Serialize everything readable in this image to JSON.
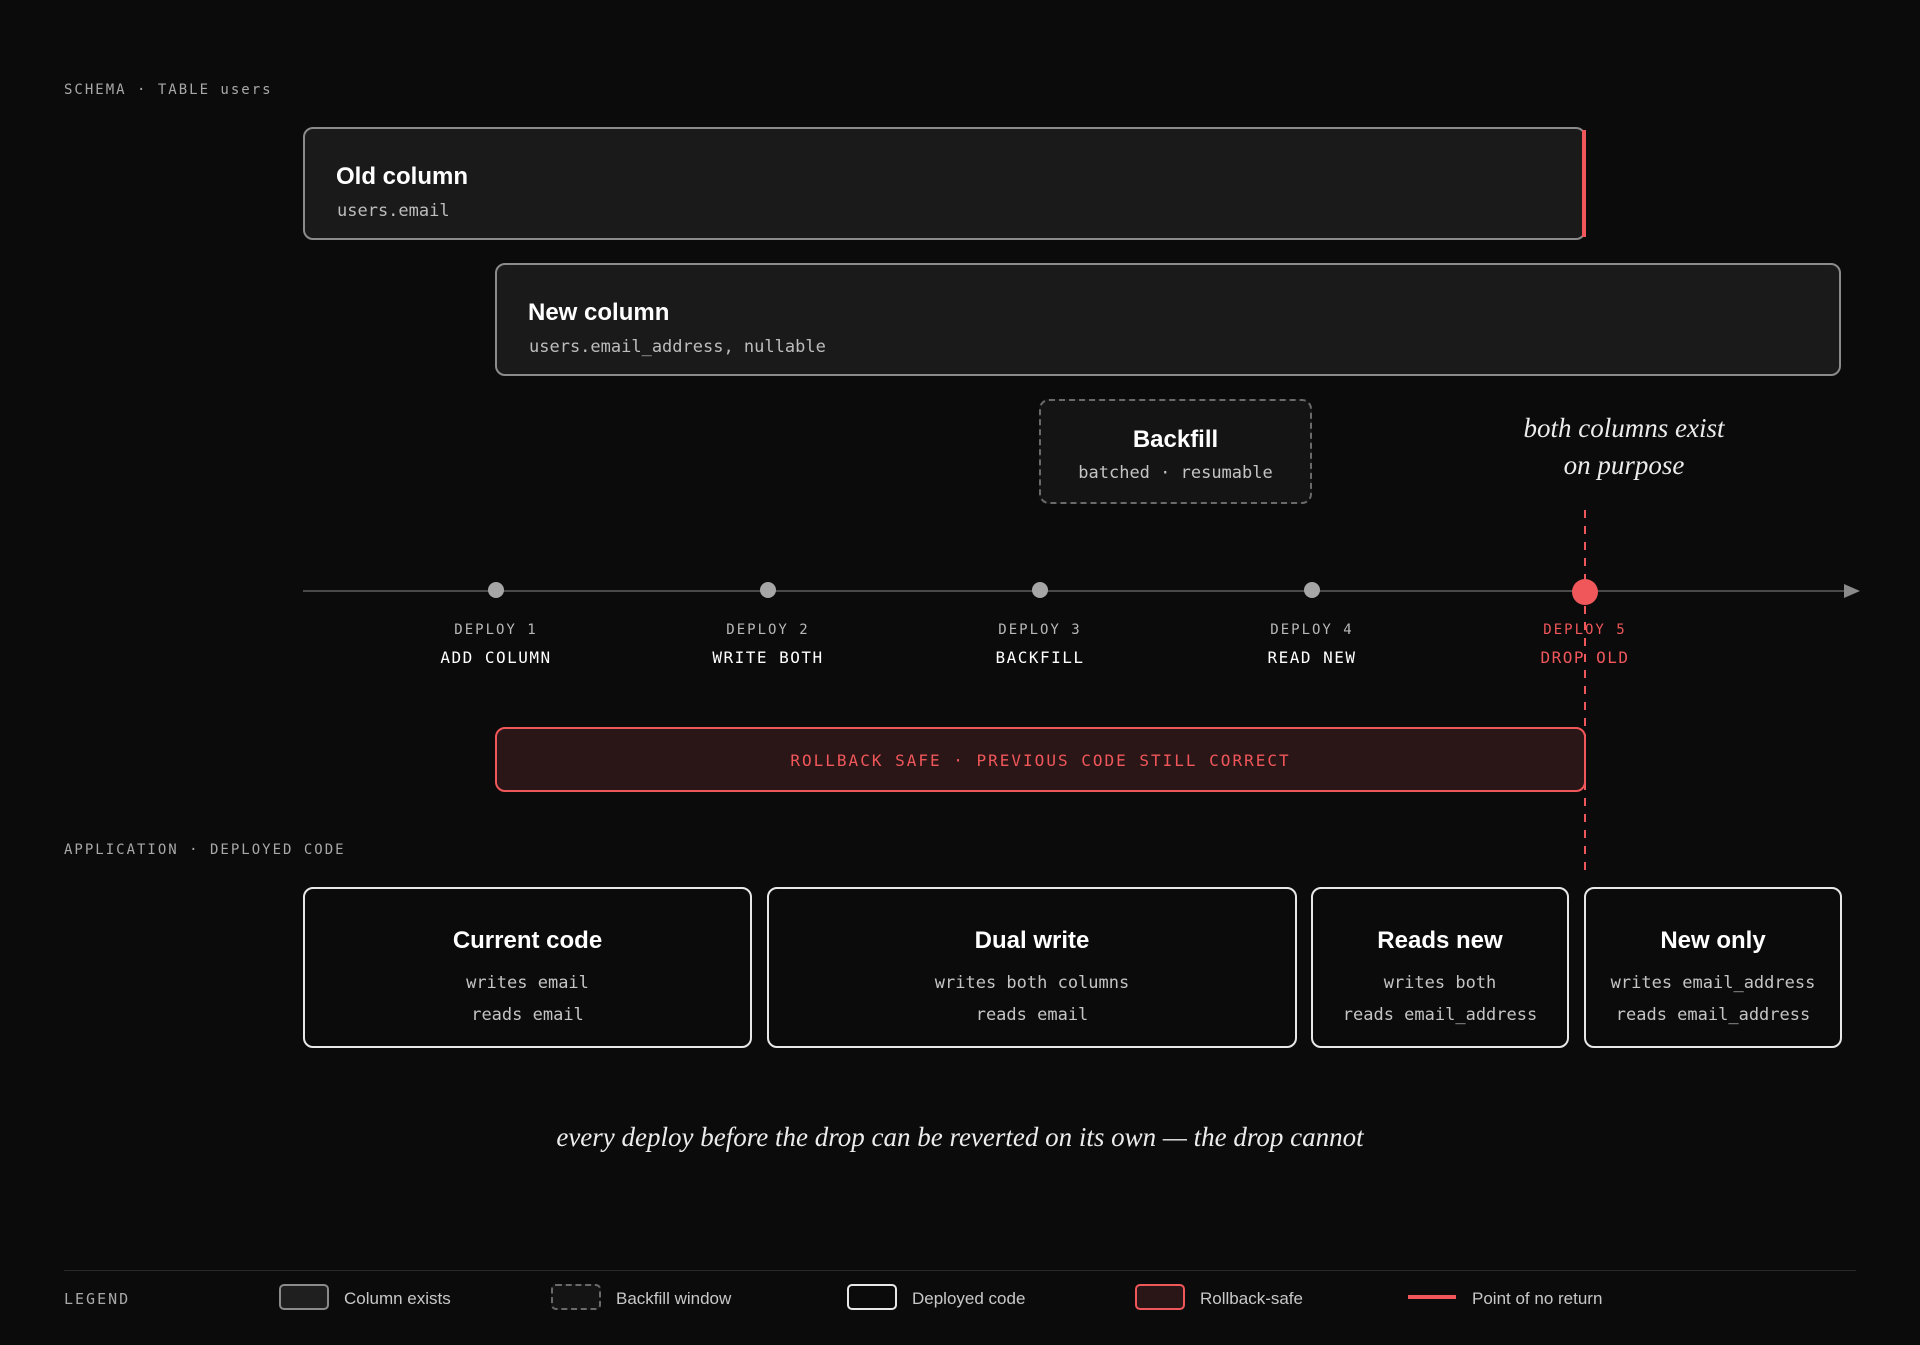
{
  "schema": {
    "label": "SCHEMA · TABLE users",
    "old_column": {
      "title": "Old column",
      "field": "users.email"
    },
    "new_column": {
      "title": "New column",
      "field": "users.email_address, nullable"
    },
    "backfill": {
      "title": "Backfill",
      "detail": "batched · resumable"
    },
    "annotation": {
      "line1": "both columns exist",
      "line2": "on purpose"
    }
  },
  "timeline": {
    "deploys": [
      {
        "number": "DEPLOY 1",
        "name": "ADD COLUMN"
      },
      {
        "number": "DEPLOY 2",
        "name": "WRITE BOTH"
      },
      {
        "number": "DEPLOY 3",
        "name": "BACKFILL"
      },
      {
        "number": "DEPLOY 4",
        "name": "READ NEW"
      },
      {
        "number": "DEPLOY 5",
        "name": "DROP OLD"
      }
    ],
    "rollback_banner": "ROLLBACK SAFE · PREVIOUS CODE STILL CORRECT"
  },
  "application": {
    "label": "APPLICATION · DEPLOYED CODE",
    "phases": [
      {
        "title": "Current code",
        "writes": "writes email",
        "reads": "reads email"
      },
      {
        "title": "Dual write",
        "writes": "writes both columns",
        "reads": "reads email"
      },
      {
        "title": "Reads new",
        "writes": "writes both",
        "reads": "reads email_address"
      },
      {
        "title": "New only",
        "writes": "writes email_address",
        "reads": "reads email_address"
      }
    ]
  },
  "footnote": "every deploy before the drop can be reverted on its own — the drop cannot",
  "legend": {
    "title": "LEGEND",
    "items": [
      {
        "label": "Column exists"
      },
      {
        "label": "Backfill window"
      },
      {
        "label": "Deployed code"
      },
      {
        "label": "Rollback-safe"
      },
      {
        "label": "Point of no return"
      }
    ]
  },
  "colors": {
    "background": "#0b0b0b",
    "accent": "#f0575a",
    "column_fill": "#1a1a1a",
    "rollback_fill": "#2a1517"
  }
}
